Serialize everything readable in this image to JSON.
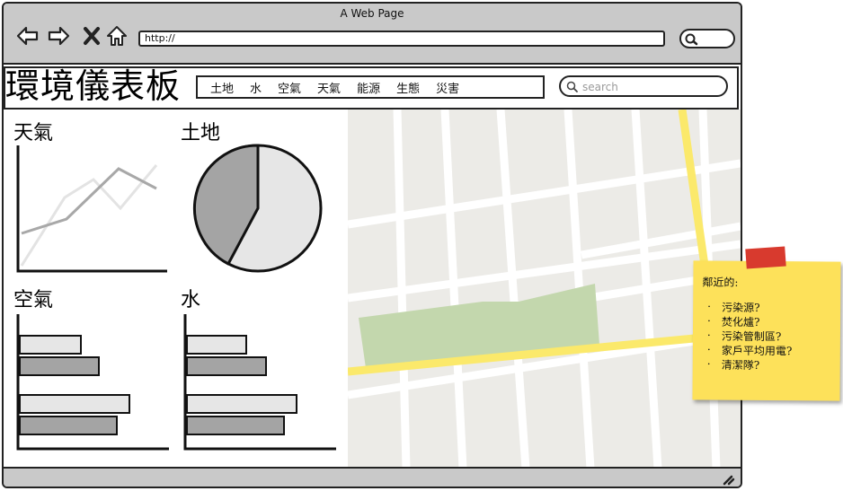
{
  "window": {
    "title": "A Web Page"
  },
  "address_bar": {
    "url": "http://"
  },
  "brand": {
    "title": "環境儀表板"
  },
  "nav": {
    "items": [
      "土地",
      "水",
      "空氣",
      "天氣",
      "能源",
      "生態",
      "災害"
    ]
  },
  "search": {
    "placeholder": "search"
  },
  "panels": {
    "weather": {
      "title": "天氣"
    },
    "land": {
      "title": "土地"
    },
    "air": {
      "title": "空氣"
    },
    "water": {
      "title": "水"
    }
  },
  "sticky": {
    "title": "鄰近的:",
    "items": [
      "污染源?",
      "焚化爐?",
      "污染管制區?",
      "家戶平均用電?",
      "清潔隊?"
    ]
  },
  "colors": {
    "chrome": "#c9c9c9",
    "map_bg": "#ecebe7",
    "map_road": "#ffffff",
    "map_highway": "#fbe96b",
    "map_park": "#c3d7ad",
    "sticky": "#fde15a",
    "tape": "#d83a2e",
    "series_dark": "#a4a4a4",
    "series_light": "#e6e6e6"
  }
}
